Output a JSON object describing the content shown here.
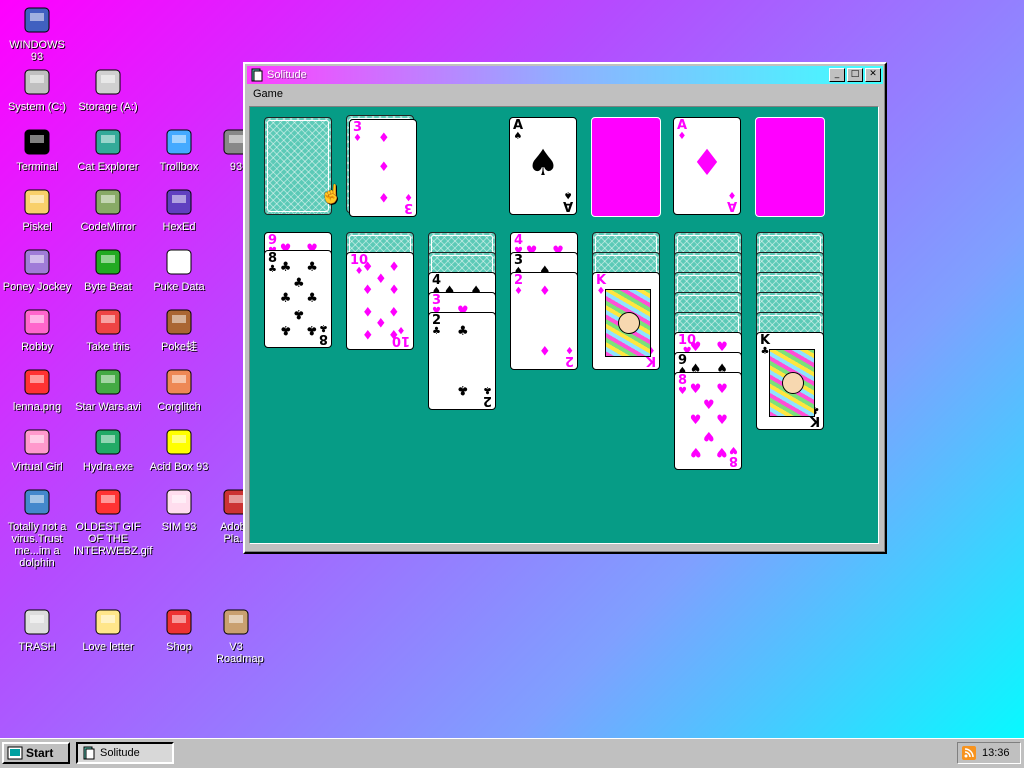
{
  "desktop": {
    "icons": [
      {
        "label": "WINDOWS 93",
        "icon": "computer-icon"
      },
      {
        "label": "System (C:)",
        "icon": "drive-icon"
      },
      {
        "label": "Storage (A:)",
        "icon": "floppy-drive-icon"
      },
      {
        "label": "Terminal",
        "icon": "terminal-icon"
      },
      {
        "label": "Cat Explorer",
        "icon": "cat-globe-icon"
      },
      {
        "label": "Trollbox",
        "icon": "chat-bubble-icon"
      },
      {
        "label": "93",
        "icon": "partial-icon"
      },
      {
        "label": "Piskel",
        "icon": "palette-icon"
      },
      {
        "label": "CodeMirror",
        "icon": "codemirror-icon"
      },
      {
        "label": "HexEd",
        "icon": "cube-icon"
      },
      {
        "label": "Poney Jockey",
        "icon": "pony-icon"
      },
      {
        "label": "Byte Beat",
        "icon": "bytebeat-icon"
      },
      {
        "label": "Puke Data",
        "icon": "pd-icon"
      },
      {
        "label": "Robby",
        "icon": "stick-figure-icon"
      },
      {
        "label": "Take this",
        "icon": "pixel-guy-icon"
      },
      {
        "label": "Poke蛙",
        "icon": "pokemon-icon"
      },
      {
        "label": "lenna.png",
        "icon": "image-file-icon"
      },
      {
        "label": "Star Wars.avi",
        "icon": "yoda-icon"
      },
      {
        "label": "Corglitch",
        "icon": "corgi-icon"
      },
      {
        "label": "Virtual Girl",
        "icon": "face-icon"
      },
      {
        "label": "Hydra.exe",
        "icon": "hydra-icon"
      },
      {
        "label": "Acid Box 93",
        "icon": "smiley-icon"
      },
      {
        "label": "Totally not a virus.Trust me...im a dolphin",
        "icon": "dolphin-icon"
      },
      {
        "label": "OLDEST GIF OF THE INTERWEBZ.gif",
        "icon": "gif-file-icon"
      },
      {
        "label": "SIM 93",
        "icon": "book-icon"
      },
      {
        "label": "Adobe Pla...",
        "icon": "partial-icon"
      },
      {
        "label": "TRASH",
        "icon": "trash-icon"
      },
      {
        "label": "Love letter",
        "icon": "envelope-icon"
      },
      {
        "label": "Shop",
        "icon": "gift-icon"
      },
      {
        "label": "V3 Roadmap",
        "icon": "map-icon"
      }
    ]
  },
  "window": {
    "title": "Solitude",
    "menu": [
      "Game"
    ],
    "buttons": {
      "minimize": "_",
      "maximize": "□",
      "close": "✕"
    }
  },
  "game": {
    "stock": "face-down",
    "waste": {
      "rank": "3",
      "suit": "♦"
    },
    "foundations": [
      {
        "rank": "A",
        "suit": "♠"
      },
      {
        "rank": "",
        "suit": ""
      },
      {
        "rank": "A",
        "suit": "♦"
      },
      {
        "rank": "",
        "suit": ""
      }
    ],
    "tableau": [
      {
        "hidden": 0,
        "cards": [
          {
            "rank": "9",
            "suit": "♥"
          },
          {
            "rank": "8",
            "suit": "♣"
          }
        ]
      },
      {
        "hidden": 1,
        "cards": [
          {
            "rank": "10",
            "suit": "♦"
          }
        ]
      },
      {
        "hidden": 2,
        "cards": [
          {
            "rank": "4",
            "suit": "♠"
          },
          {
            "rank": "3",
            "suit": "♥"
          },
          {
            "rank": "2",
            "suit": "♣"
          }
        ]
      },
      {
        "hidden": 0,
        "cards": [
          {
            "rank": "4",
            "suit": "♥"
          },
          {
            "rank": "3",
            "suit": "♠"
          },
          {
            "rank": "2",
            "suit": "♦"
          }
        ]
      },
      {
        "hidden": 2,
        "cards": [
          {
            "rank": "K",
            "suit": "♦"
          }
        ]
      },
      {
        "hidden": 5,
        "cards": [
          {
            "rank": "10",
            "suit": "♥"
          },
          {
            "rank": "9",
            "suit": "♠"
          },
          {
            "rank": "8",
            "suit": "♥"
          }
        ]
      },
      {
        "hidden": 5,
        "cards": [
          {
            "rank": "K",
            "suit": "♣"
          }
        ]
      }
    ]
  },
  "taskbar": {
    "start_label": "Start",
    "tasks": [
      {
        "label": "Solitude"
      }
    ],
    "clock": "13:36"
  },
  "colors": {
    "felt": "#069c86",
    "accent": "#ff00ff"
  }
}
